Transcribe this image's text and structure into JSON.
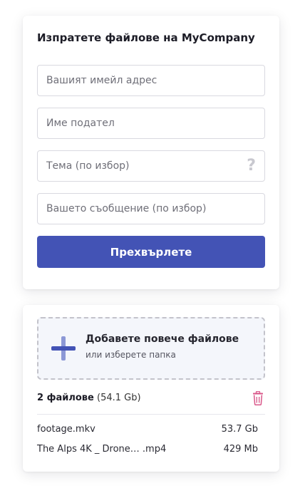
{
  "form": {
    "title": "Изпратете файлове на MyCompany",
    "fields": [
      {
        "placeholder": "Вашият имейл адрес",
        "value": ""
      },
      {
        "placeholder": "Име подател",
        "value": ""
      },
      {
        "placeholder": "Тема (по избор)",
        "value": "",
        "help_icon": "?"
      },
      {
        "placeholder": "Вашето съобщение (по избор)",
        "value": ""
      }
    ],
    "submit_label": "Прехвърлете"
  },
  "upload": {
    "add_files_label": "Добавете повече файлове",
    "select_folder_label": "или изберете папка",
    "summary_count": "2 файлове",
    "summary_size": "(54.1 Gb)",
    "files": [
      {
        "name": "footage.mkv",
        "size": "53.7 Gb"
      },
      {
        "name": "The Alps 4K _ Drone… .mp4",
        "size": "429 Mb"
      }
    ]
  },
  "colors": {
    "accent": "#4353b5",
    "accent_light": "#8c98d6",
    "delete": "#d9578a",
    "dropzone_bg": "#f4f6fb"
  },
  "icons": {
    "add": "plus-icon",
    "help": "question-mark-icon",
    "delete": "trash-icon"
  }
}
